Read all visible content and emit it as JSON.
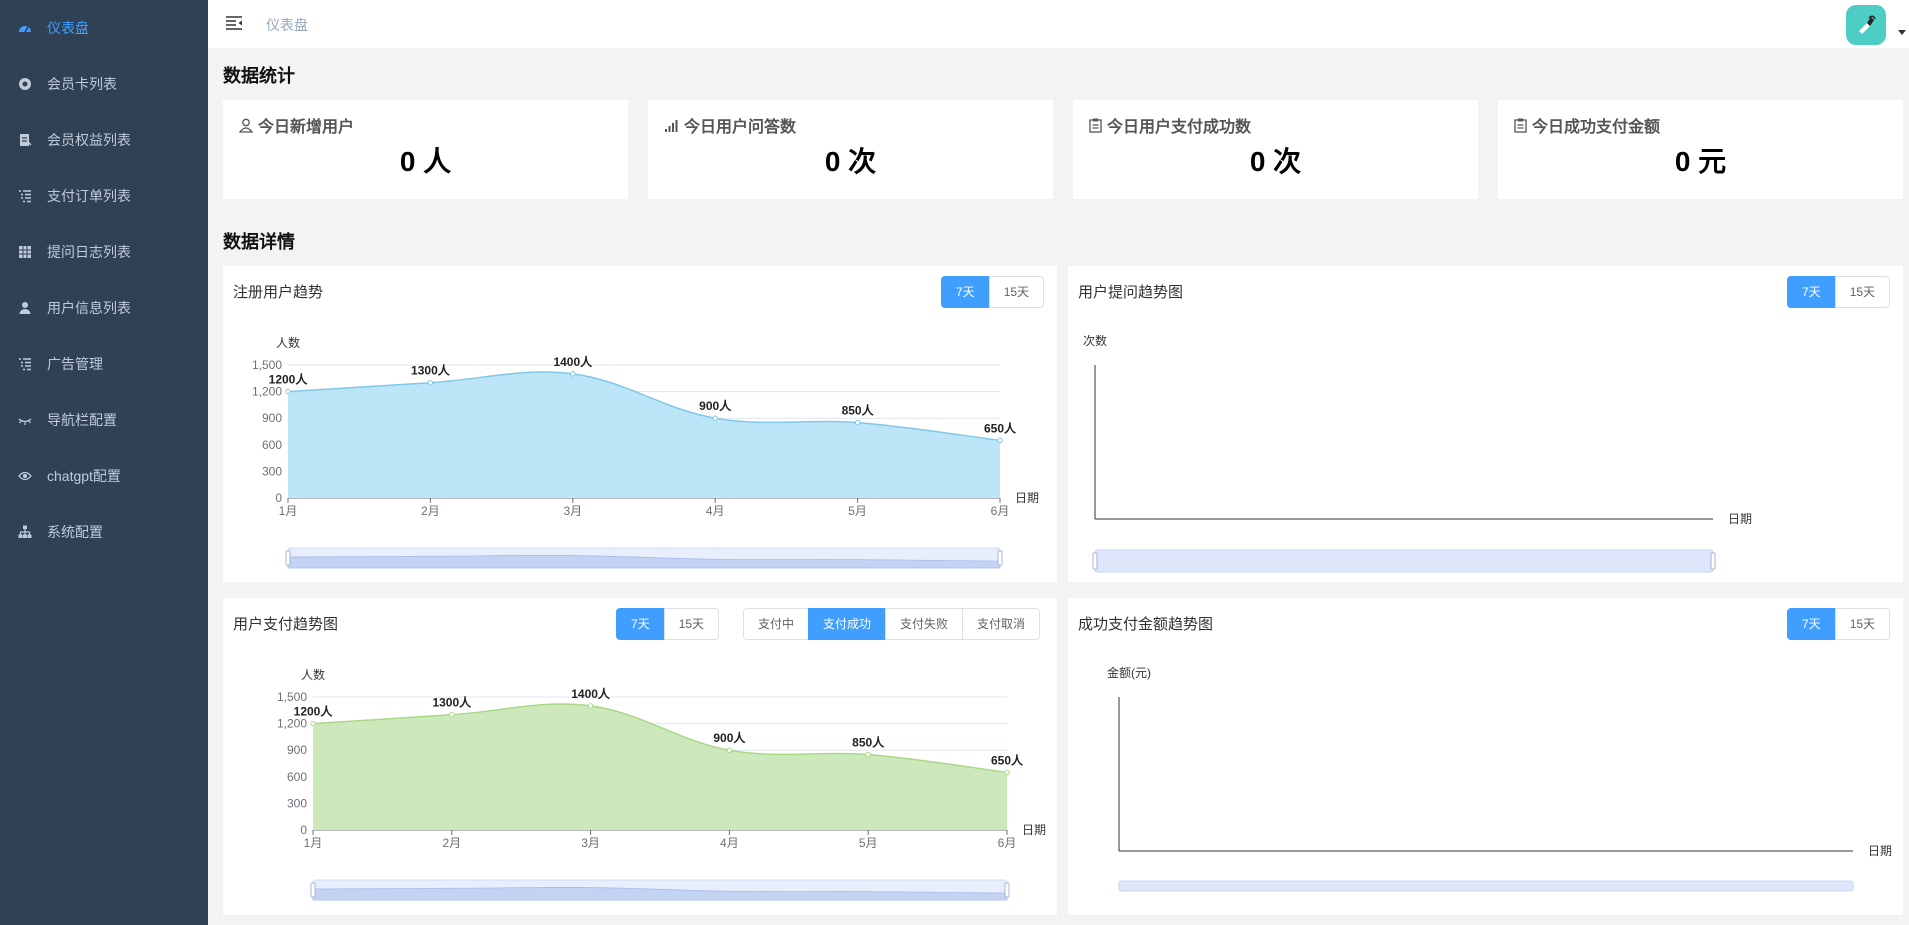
{
  "sidebar": {
    "items": [
      {
        "label": "仪表盘",
        "icon": "dashboard-icon"
      },
      {
        "label": "会员卡列表",
        "icon": "chrome-icon"
      },
      {
        "label": "会员权益列表",
        "icon": "document-icon"
      },
      {
        "label": "支付订单列表",
        "icon": "list-icon"
      },
      {
        "label": "提问日志列表",
        "icon": "table-icon"
      },
      {
        "label": "用户信息列表",
        "icon": "user-icon"
      },
      {
        "label": "广告管理",
        "icon": "list-icon"
      },
      {
        "label": "导航栏配置",
        "icon": "eye-closed-icon"
      },
      {
        "label": "chatgpt配置",
        "icon": "eye-icon"
      },
      {
        "label": "系统配置",
        "icon": "tree-icon"
      }
    ],
    "active_index": 0,
    "colors": {
      "background": "#304156",
      "text": "#bfcbd9",
      "active": "#409eff"
    }
  },
  "header": {
    "breadcrumb": "仪表盘",
    "avatar_color": "#4ecdc4"
  },
  "sections": {
    "stats_title": "数据统计",
    "details_title": "数据详情"
  },
  "stats": [
    {
      "title": "今日新增用户",
      "value": "0 人",
      "icon": "user-icon"
    },
    {
      "title": "今日用户问答数",
      "value": "0 次",
      "icon": "signal-icon"
    },
    {
      "title": "今日用户支付成功数",
      "value": "0 次",
      "icon": "clipboard-icon"
    },
    {
      "title": "今日成功支付金额",
      "value": "0 元",
      "icon": "clipboard-icon"
    }
  ],
  "range_buttons": [
    "7天",
    "15天"
  ],
  "pay_status_buttons": [
    "支付中",
    "支付成功",
    "支付失败",
    "支付取消"
  ],
  "pay_status_active": 1,
  "cards": {
    "register": {
      "title": "注册用户趋势"
    },
    "questions": {
      "title": "用户提问趋势图"
    },
    "payments": {
      "title": "用户支付趋势图"
    },
    "amount": {
      "title": "成功支付金额趋势图"
    }
  },
  "chart_data": [
    {
      "type": "area",
      "title": "注册用户趋势",
      "categories": [
        "1月",
        "2月",
        "3月",
        "4月",
        "5月",
        "6月"
      ],
      "series": [
        {
          "values": [
            1200,
            1300,
            1400,
            900,
            850,
            650
          ]
        }
      ],
      "data_label_suffix": "人",
      "ylabel": "人数",
      "xlabel": "日期",
      "ylim": [
        0,
        1500
      ],
      "yticks": [
        "0",
        "300",
        "600",
        "900",
        "1,200",
        "1,500"
      ],
      "color": "#80c8ea",
      "fill": "#bde5f8",
      "grid": true
    },
    {
      "type": "line",
      "title": "用户提问趋势图",
      "categories": [],
      "series": [],
      "ylabel": "次数",
      "xlabel": "日期"
    },
    {
      "type": "area",
      "title": "用户支付趋势图",
      "categories": [
        "1月",
        "2月",
        "3月",
        "4月",
        "5月",
        "6月"
      ],
      "series": [
        {
          "values": [
            1200,
            1300,
            1400,
            900,
            850,
            650
          ]
        }
      ],
      "data_label_suffix": "人",
      "ylabel": "人数",
      "xlabel": "日期",
      "ylim": [
        0,
        1500
      ],
      "yticks": [
        "0",
        "300",
        "600",
        "900",
        "1,200",
        "1,500"
      ],
      "color": "#a9d887",
      "fill": "#cde9bc",
      "grid": true
    },
    {
      "type": "line",
      "title": "成功支付金额趋势图",
      "categories": [],
      "series": [],
      "ylabel": "金额(元)",
      "xlabel": "日期"
    }
  ]
}
